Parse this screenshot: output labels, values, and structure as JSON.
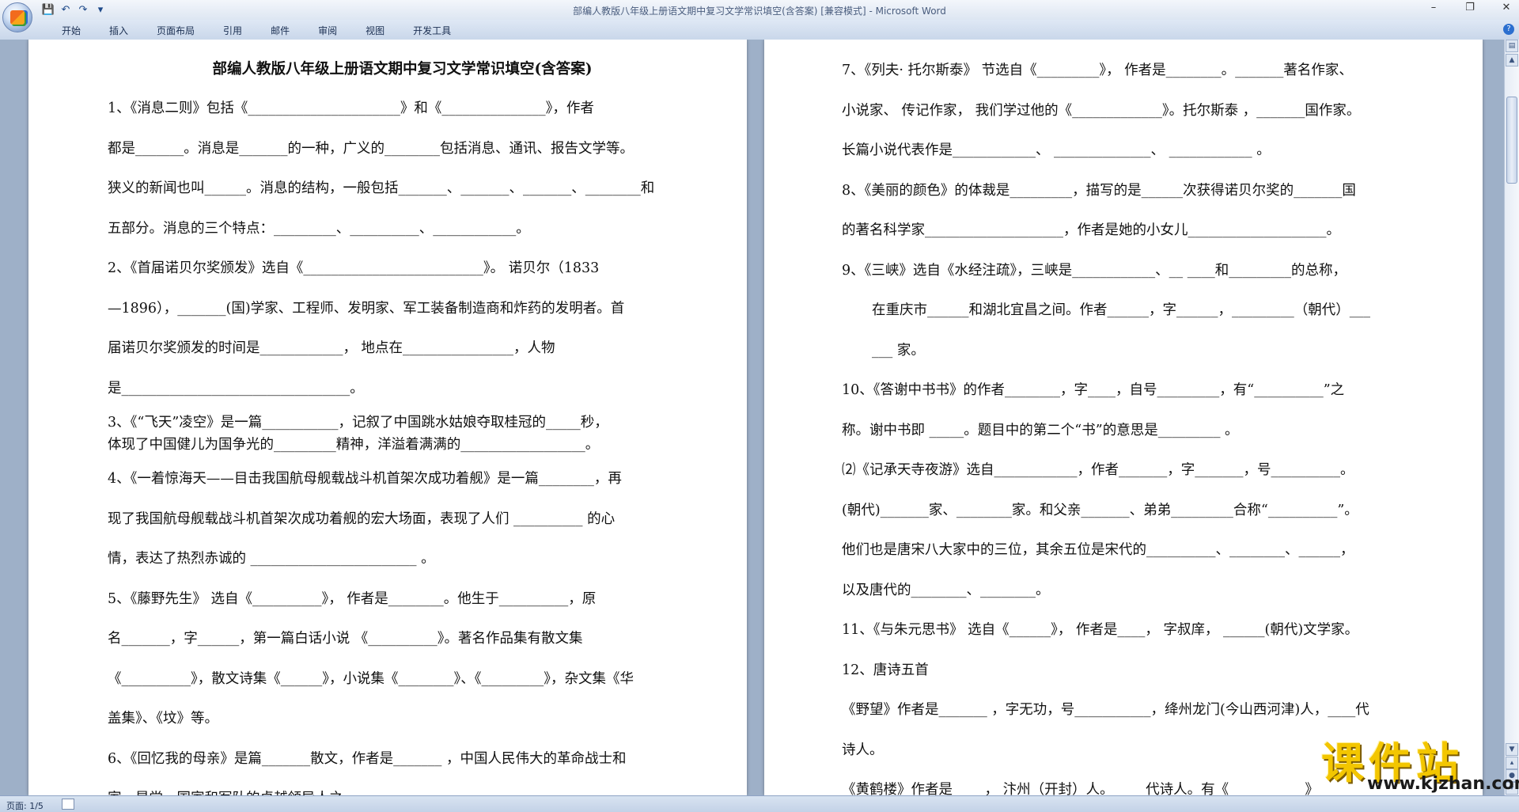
{
  "window": {
    "title": "部编人教版八年级上册语文期中复习文学常识填空(含答案) [兼容模式] - Microsoft Word",
    "controls": [
      "–",
      "❐",
      "✕"
    ]
  },
  "quick_access": {
    "save": "💾",
    "undo": "↶",
    "redo": "↷",
    "more": "▾"
  },
  "ribbon": {
    "tabs": [
      "开始",
      "插入",
      "页面布局",
      "引用",
      "邮件",
      "审阅",
      "视图",
      "开发工具"
    ],
    "help": "?"
  },
  "document": {
    "left_page": {
      "title": "部编人教版八年级上册语文期中复习文学常识填空(含答案)",
      "lines": [
        "1、《消息二则》包括《______________________》和《_______________》，作者",
        "都是_______。消息是_______的一种，广义的________包括消息、通讯、报告文学等。",
        "狭义的新闻也叫______。消息的结构，一般包括_______、_______、_______、________和",
        "五部分。消息的三个特点：_________、__________、____________。",
        "2、《首届诺贝尔奖颁发》选自《__________________________》。 诺贝尔（1833",
        "—1896），_______(国)学家、工程师、发明家、军工装备制造商和炸药的发明者。首",
        "届诺贝尔奖颁发的时间是____________，    地点在________________，人物",
        "是_________________________________。"
      ],
      "tight_lines": [
        "3、《“飞天”凌空》是一篇___________，记叙了中国跳水姑娘夺取桂冠的_____秒，",
        "体现了中国健儿为国争光的_________精神，洋溢着满满的__________________。"
      ],
      "lines_b": [
        "4、《一着惊海天——目击我国航母舰载战斗机首架次成功着舰》是一篇________，再",
        "现了我国航母舰载战斗机首架次成功着舰的宏大场面，表现了人们 __________  的心",
        "情，表达了热烈赤诚的 ________________________  。",
        "5、《藤野先生》  选自《__________》， 作者是________。他生于__________，原",
        "名_______，字______，第一篇白话小说 《__________》。著名作品集有散文集",
        "《__________》，散文诗集《______》，小说集《________》、《_________》，杂文集《华",
        "盖集》、《坟》等。",
        "6、《回忆我的母亲》是篇_______散文，作者是_______ ，中国人民伟大的革命战士和",
        "家，是党、国家和军队的卓越领导人之一。"
      ]
    },
    "right_page": {
      "lines": [
        "7、《列夫· 托尔斯泰》 节选自《_________》， 作者是________。_______著名作家、",
        "小说家、 传记作家， 我们学过他的《_____________》。托尔斯泰 ，_______国作家。",
        "长篇小说代表作是____________、 ______________、 ____________   。",
        "8、《美丽的颜色》的体裁是_________，描写的是______次获得诺贝尔奖的_______国",
        "的著名科学家____________________，作者是她的小女儿____________________。"
      ],
      "indented": [
        "9、《三峡》选自《水经注疏》，三峡是____________、__    ____和_________的总称，",
        "在重庆市______和湖北宜昌之间。作者______，字______，_________（朝代）___",
        "___ 家。"
      ],
      "lines_b": [
        "10、《答谢中书书》的作者________，字____，自号_________，有“__________”之",
        "称。谢中书即 _____。题目中的第二个“书”的意思是_________  。",
        "⑵《记承天寺夜游》选自____________，作者_______，字_______，号__________。",
        "(朝代)_______家、________家。和父亲_______、弟弟_________合称“__________”。",
        "他们也是唐宋八大家中的三位，其余五位是宋代的__________、________、______，",
        "以及唐代的________、________。",
        "11、《与朱元思书》 选自《______》， 作者是____， 字叔庠， ______(朝代)文学家。",
        "12、唐诗五首",
        "《野望》作者是_______ ，字无功，号___________，绛州龙门(今山西河津)人，____代",
        "诗人。",
        "《黄鹤楼》作者是____ ， 汴州（开封）人。 ____代诗人。有《___________》"
      ]
    }
  },
  "status": {
    "page": "页面: 1/5"
  },
  "watermark": {
    "main": "课件站",
    "sub": "www.kjzhan.com"
  },
  "colors": {
    "workspace": "#9eb0c8",
    "ribbon": "#dfe8f5",
    "watermark_yellow": "#f3c600"
  }
}
